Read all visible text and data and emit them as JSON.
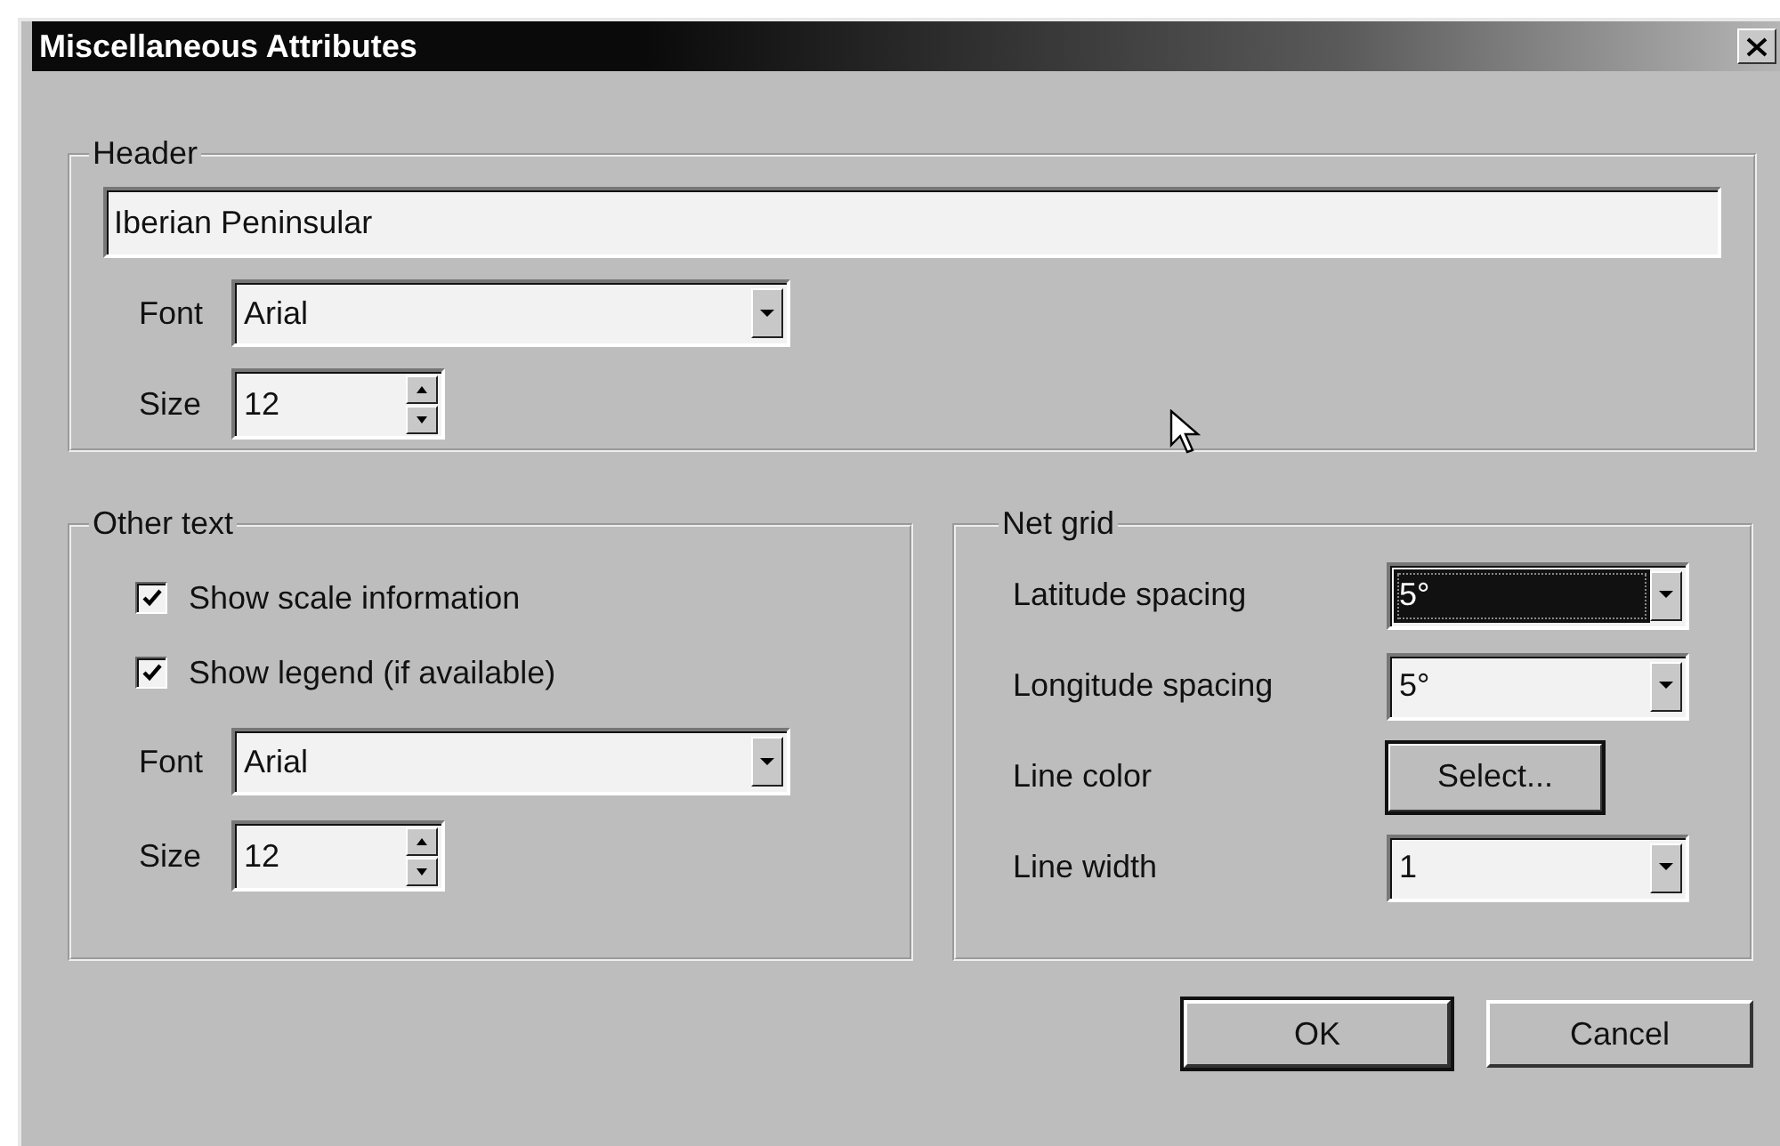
{
  "window": {
    "title": "Miscellaneous Attributes"
  },
  "header": {
    "legend": "Header",
    "text": "Iberian Peninsular",
    "font": {
      "label": "Font",
      "value": "Arial"
    },
    "size": {
      "label": "Size",
      "value": "12"
    }
  },
  "other_text": {
    "legend": "Other text",
    "checkboxes": [
      {
        "label": "Show scale information",
        "checked": true
      },
      {
        "label": "Show legend (if available)",
        "checked": true
      }
    ],
    "font": {
      "label": "Font",
      "value": "Arial"
    },
    "size": {
      "label": "Size",
      "value": "12"
    }
  },
  "net_grid": {
    "legend": "Net grid",
    "rows": [
      {
        "kind": "combo",
        "label": "Latitude spacing",
        "value": "5°",
        "focused": true
      },
      {
        "kind": "combo",
        "label": "Longitude spacing",
        "value": "5°",
        "focused": false
      },
      {
        "kind": "button",
        "label": "Line color",
        "button": "Select..."
      },
      {
        "kind": "combo",
        "label": "Line width",
        "value": "1",
        "focused": false
      }
    ]
  },
  "buttons": [
    "OK",
    "Cancel"
  ]
}
